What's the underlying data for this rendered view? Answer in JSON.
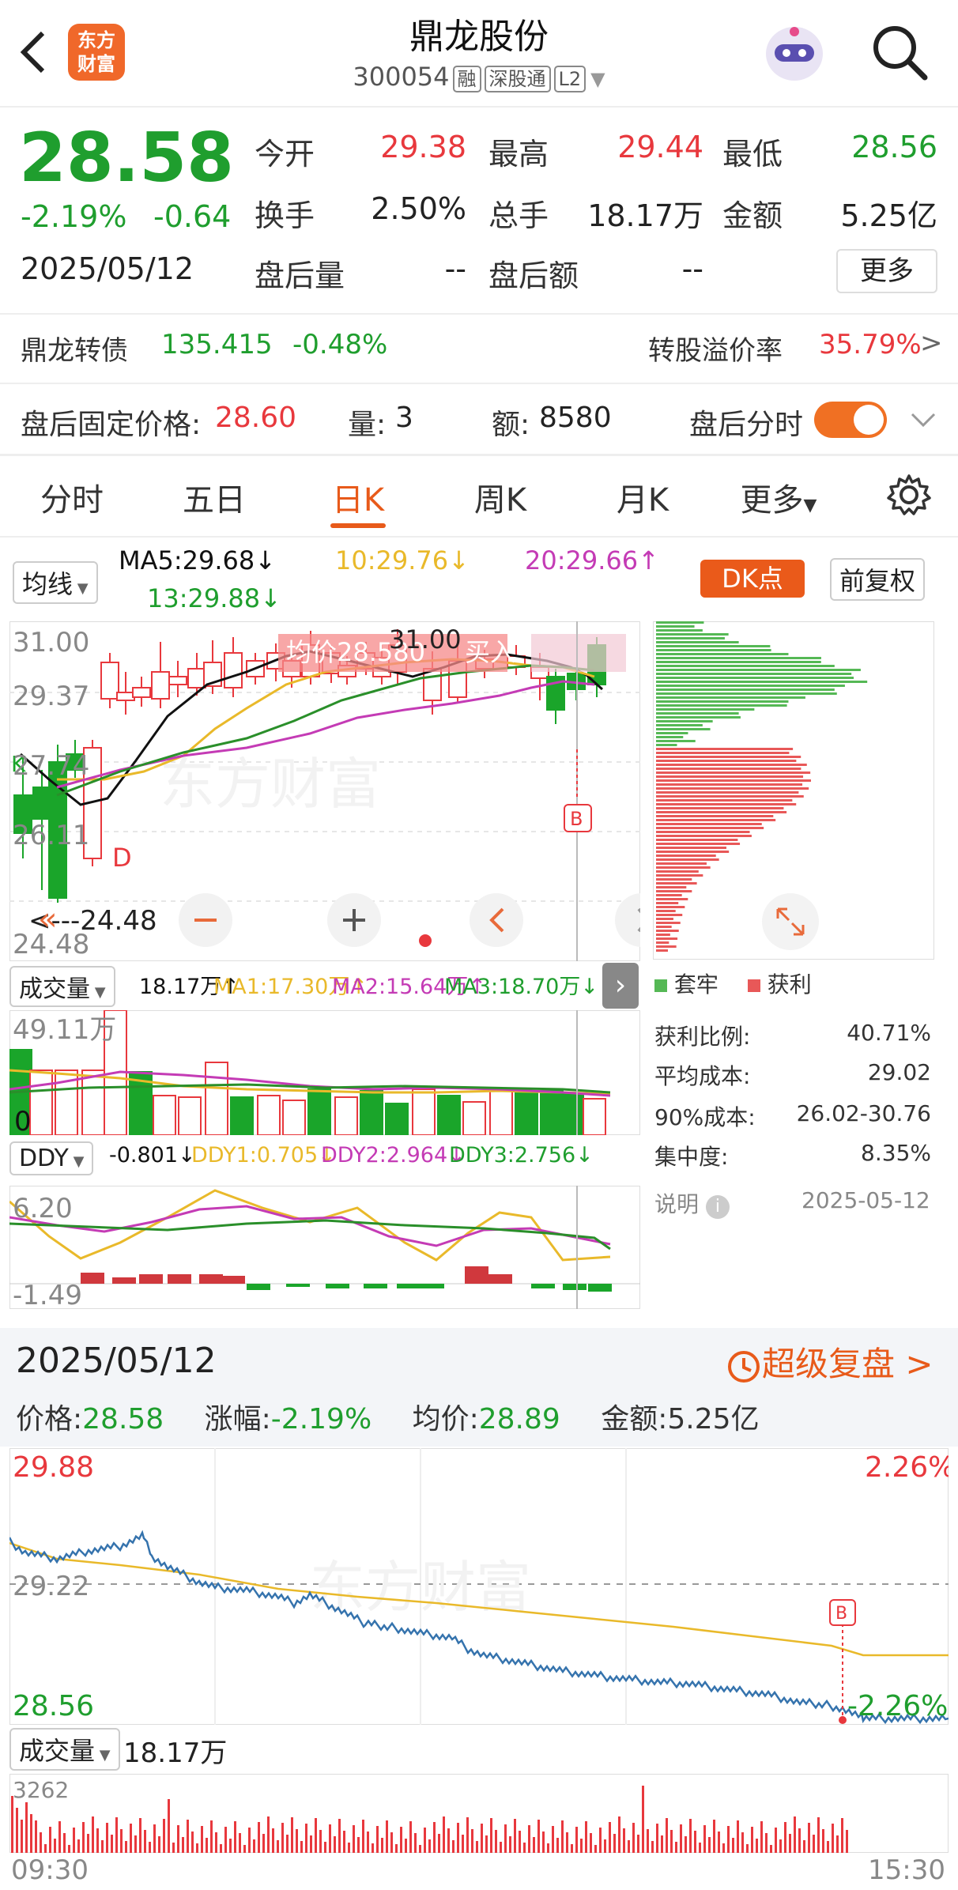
{
  "header": {
    "title": "鼎龙股份",
    "code": "300054",
    "tags": [
      "融",
      "深股通",
      "L2"
    ],
    "brand": "东方\n财富"
  },
  "quote": {
    "price": "28.58",
    "change_pct": "-2.19%",
    "change": "-0.64",
    "date": "2025/05/12",
    "open_label": "今开",
    "open": "29.38",
    "high_label": "最高",
    "high": "29.44",
    "low_label": "最低",
    "low": "28.56",
    "turnover_label": "换手",
    "turnover": "2.50%",
    "volume_label": "总手",
    "volume": "18.17万",
    "amount_label": "金额",
    "amount": "5.25亿",
    "ah_vol_label": "盘后量",
    "ah_vol": "--",
    "ah_amt_label": "盘后额",
    "ah_amt": "--",
    "more": "更多"
  },
  "bond": {
    "name": "鼎龙转债",
    "price": "135.415",
    "change": "-0.48%",
    "premium_label": "转股溢价率",
    "premium": "35.79%",
    "arrow": ">"
  },
  "afterhours": {
    "fixed_label": "盘后固定价格:",
    "fixed": "28.60",
    "vol_label": "量:",
    "vol": "3",
    "amt_label": "额:",
    "amt": "8580",
    "timeshare_label": "盘后分时",
    "toggle_on": true
  },
  "tabs": [
    "分时",
    "五日",
    "日K",
    "周K",
    "月K",
    "更多"
  ],
  "active_tab": "日K",
  "kchart": {
    "ma_chip": "均线",
    "ma5": "MA5:29.68↓",
    "ma10": "10:29.76↓",
    "ma20": "20:29.66↑",
    "ma13": "13:29.88↓",
    "dk_btn": "DK点",
    "fq_btn": "前复权",
    "y_labels": [
      "31.00",
      "29.37",
      "27.74",
      "26.11",
      "24.48"
    ],
    "hi_marker": "31.00",
    "lo_marker": "24.48",
    "avg_tip": "均价28.580",
    "buy_tip": "买入",
    "d_label": "D",
    "k_label": "K",
    "b_label": "B",
    "watermark": "东方财富",
    "colors": {
      "up": "#e8383d",
      "down": "#1aa52a",
      "ma5": "#111111",
      "ma10": "#e9b92a",
      "ma20": "#c43bb5",
      "ma30": "#2a8f2a"
    }
  },
  "chips": {
    "trapped": "套牢",
    "profit": "获利",
    "stats": [
      {
        "label": "获利比例:",
        "value": "40.71%"
      },
      {
        "label": "平均成本:",
        "value": "29.02"
      },
      {
        "label": "90%成本:",
        "value": "26.02-30.76"
      },
      {
        "label": "集中度:",
        "value": "8.35%"
      }
    ],
    "note": "说明",
    "note_date": "2025-05-12"
  },
  "volume": {
    "chip": "成交量",
    "total": "18.17万↑",
    "ma1": "MA1:17.30万↑",
    "ma2": "MA2:15.64万↑",
    "ma3": "MA3:18.70万↓",
    "top": "49.11万",
    "zero": "0"
  },
  "ddy": {
    "chip": "DDY",
    "val": "-0.801↓",
    "d1": "DDY1:0.705↓",
    "d2": "DDY2:2.964↓",
    "d3": "DDY3:2.756↓",
    "top": "6.20",
    "bot": "-1.49"
  },
  "intraday": {
    "date": "2025/05/12",
    "review": "超级复盘 >",
    "price_label": "价格:",
    "price": "28.58",
    "chg_label": "涨幅:",
    "chg": "-2.19%",
    "avg_label": "均价:",
    "avg": "28.89",
    "amt_label": "金额:",
    "amt": "5.25亿",
    "y_top": "29.88",
    "y_mid": "29.22",
    "y_bot": "28.56",
    "pct_top": "2.26%",
    "pct_bot": "-2.26%",
    "b_label": "B",
    "vol_chip": "成交量",
    "vol_total": "18.17万",
    "vol_max": "3262",
    "t_start": "09:30",
    "t_end": "15:30",
    "watermark": "东方财富"
  }
}
